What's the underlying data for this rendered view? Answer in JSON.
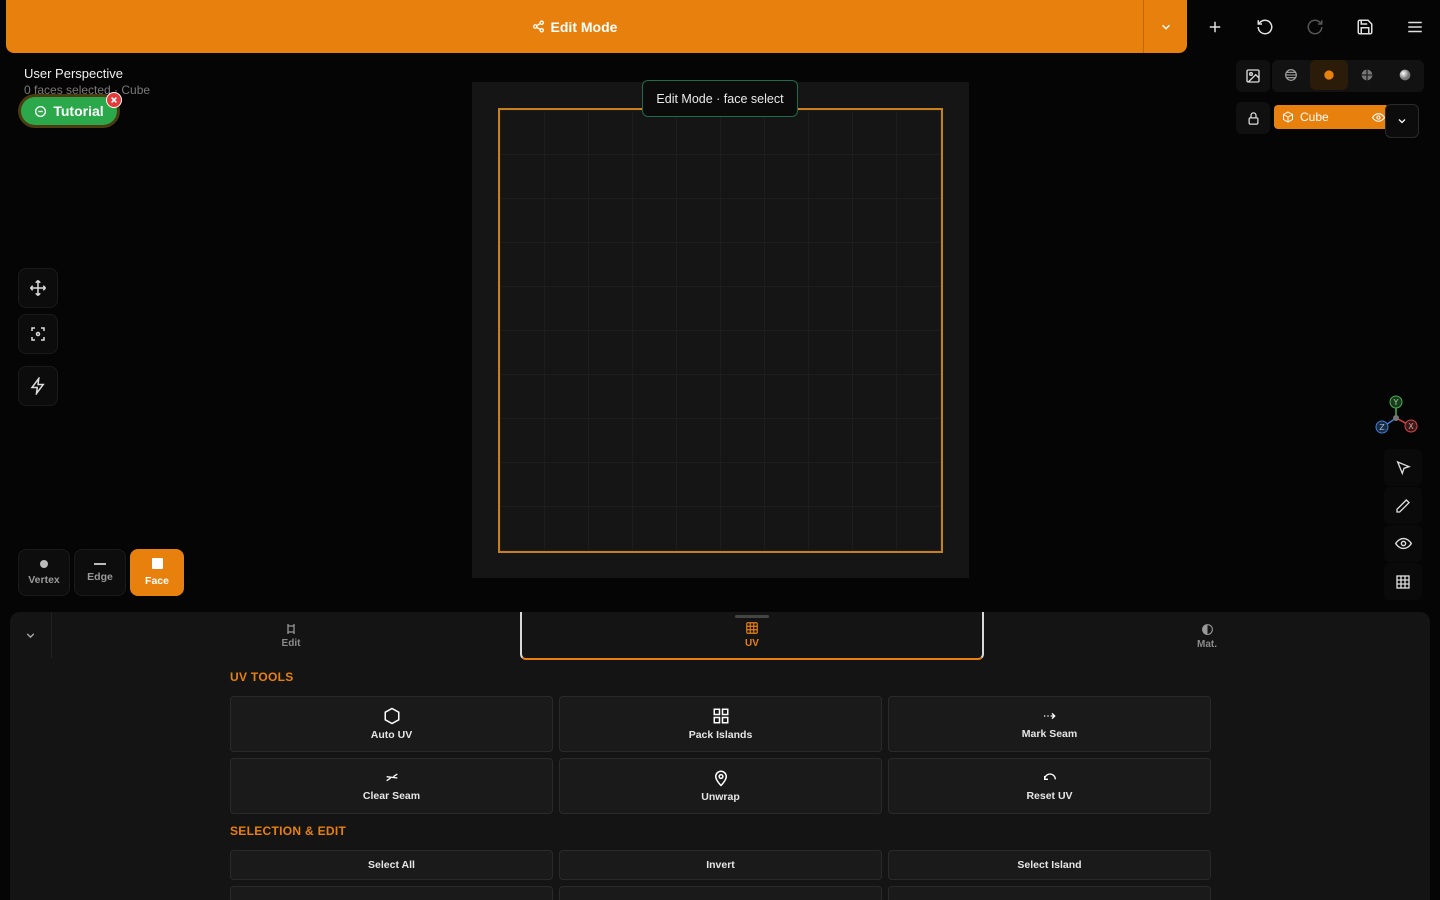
{
  "topbar": {
    "mode_label": "Edit Mode"
  },
  "viewport": {
    "title": "User Perspective",
    "subtitle": "0 faces selected · Cube",
    "tutorial_label": "Tutorial",
    "canvas_label": "Edit Mode · face select"
  },
  "select_modes": [
    {
      "label": "Vertex"
    },
    {
      "label": "Edge"
    },
    {
      "label": "Face",
      "active": true
    }
  ],
  "object": {
    "name": "Cube"
  },
  "axis_labels": {
    "y": "Y",
    "z": "Z",
    "x": "X"
  },
  "panel": {
    "tabs": [
      {
        "label": "Edit"
      },
      {
        "label": "UV",
        "active": true
      },
      {
        "label": "Mat."
      }
    ],
    "uv_tools_title": "UV TOOLS",
    "uv_tools": [
      {
        "label": "Auto UV",
        "icon": "hexagon-icon"
      },
      {
        "label": "Pack Islands",
        "icon": "grid-icon"
      },
      {
        "label": "Mark Seam",
        "icon": "arrow-dashed-icon"
      },
      {
        "label": "Clear Seam",
        "icon": "seam-clear-icon"
      },
      {
        "label": "Unwrap",
        "icon": "map-pin-icon"
      },
      {
        "label": "Reset UV",
        "icon": "undo-icon"
      }
    ],
    "selection_title": "SELECTION & EDIT",
    "selection": [
      {
        "label": "Select All"
      },
      {
        "label": "Invert"
      },
      {
        "label": "Select Island"
      }
    ]
  },
  "colors": {
    "accent": "#e8800e",
    "background": "#050505",
    "panel": "#141414",
    "success": "#2aa84a"
  }
}
